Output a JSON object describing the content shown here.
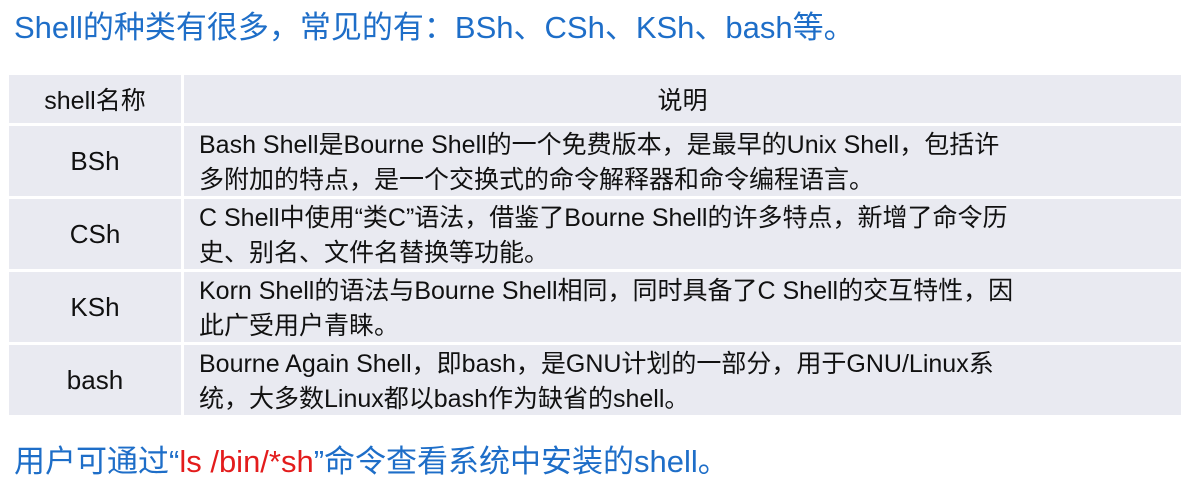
{
  "heading": {
    "text": "Shell的种类有很多，常见的有：BSh、CSh、KSh、bash等。",
    "color": "#1e6ec8"
  },
  "table": {
    "headers": {
      "name": "shell名称",
      "description": "说明"
    },
    "cell_color": "#e9eaf1",
    "rows": [
      {
        "name": "BSh",
        "description_lines": [
          "Bash Shell是Bourne Shell的一个免费版本，是最早的Unix Shell，包括许",
          "多附加的特点，是一个交换式的命令解释器和命令编程语言。"
        ]
      },
      {
        "name": "CSh",
        "description_lines": [
          "C Shell中使用“类C”语法，借鉴了Bourne Shell的许多特点，新增了命令历",
          "史、别名、文件名替换等功能。"
        ]
      },
      {
        "name": "KSh",
        "description_lines": [
          "Korn Shell的语法与Bourne Shell相同，同时具备了C Shell的交互特性，因",
          "此广受用户青睐。"
        ]
      },
      {
        "name": "bash",
        "description_lines": [
          "Bourne Again Shell，即bash，是GNU计划的一部分，用于GNU/Linux系",
          "统，大多数Linux都以bash作为缺省的shell。"
        ]
      }
    ]
  },
  "footer": {
    "prefix": "用户可通过“",
    "command": "ls /bin/*sh",
    "suffix": "”命令查看系统中安装的shell。",
    "text_color": "#1e6ec8",
    "command_color": "#e31c1c"
  }
}
